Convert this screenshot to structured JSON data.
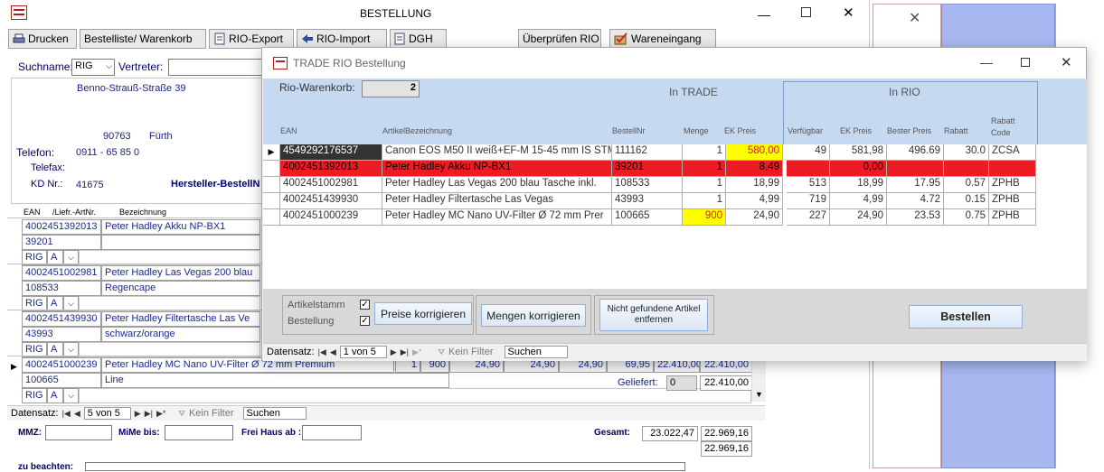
{
  "main_window": {
    "title": "BESTELLUNG",
    "toolbar": [
      {
        "label": "Drucken",
        "icon": "printer-icon"
      },
      {
        "label": "Bestelliste/ Warenkorb",
        "icon": ""
      },
      {
        "label": "RIO-Export",
        "icon": "export-icon"
      },
      {
        "label": "RIO-Import",
        "icon": "import-arrow-icon"
      },
      {
        "label": "DGH",
        "icon": "document-icon"
      },
      {
        "label": "Überprüfen RIO",
        "icon": ""
      },
      {
        "label": "Wareneingang",
        "icon": "goods-receipt-icon"
      }
    ],
    "search_label": "Suchname:",
    "search_value": "RIG",
    "vertreter_label": "Vertreter:",
    "address_street": "Benno-Strauß-Straße 39",
    "address_zip": "90763",
    "address_city": "Fürth",
    "telefon_label": "Telefon:",
    "telefon_value": "0911 - 65 85 0",
    "telefax_label": "Telefax:",
    "kd_label": "KD Nr.:",
    "kd_value": "41675",
    "hersteller_label": "Hersteller-BestellN",
    "list_headers": {
      "ean": "EAN",
      "liefr": "/Liefr.-ArtNr.",
      "bez": "Bezeichnung"
    },
    "items": [
      {
        "ean": "4002451392013",
        "name": "Peter Hadley Akku NP-BX1",
        "art": "39201",
        "sub": "",
        "code": "RIG",
        "flag": "A"
      },
      {
        "ean": "4002451002981",
        "name": "Peter Hadley Las Vegas 200 blau",
        "art": "108533",
        "sub": "Regencape",
        "code": "RIG",
        "flag": "A"
      },
      {
        "ean": "4002451439930",
        "name": "Peter Hadley Filtertasche Las Ve",
        "art": "43993",
        "sub": "schwarz/orange",
        "code": "RIG",
        "flag": "A"
      },
      {
        "ean": "4002451000239",
        "name": "Peter Hadley MC Nano UV-Filter Ø 72 mm Premium",
        "art": "100665",
        "sub": "Line",
        "code": "RIG",
        "flag": "A"
      }
    ],
    "last_row_values": [
      "1",
      "900",
      "24,90",
      "24,90",
      "24,90",
      "69,95",
      "22.410,00",
      "22.410,00"
    ],
    "geliefert_label": "Geliefert:",
    "geliefert_value": "0",
    "geliefert_total": "22.410,00",
    "nav_label": "Datensatz:",
    "nav_value": "5 von 5",
    "nav_filter": "Kein Filter",
    "nav_search": "Suchen",
    "mmz_label": "MMZ:",
    "mime_label": "MiMe bis:",
    "freihaus_label": "Frei Haus ab :",
    "gesamt_label": "Gesamt:",
    "gesamt_value1": "23.022,47",
    "gesamt_value2": "22.969,16",
    "gesamt_value3": "22.969,16",
    "beachten_label": "zu beachten:"
  },
  "rio_window": {
    "title": "TRADE RIO Bestellung",
    "warenkorb_label": "Rio-Warenkorb:",
    "warenkorb_value": "2",
    "in_trade": "In TRADE",
    "in_rio": "In RIO",
    "headers": {
      "ean": "EAN",
      "artikel": "ArtikelBezeichnung",
      "bestellnr": "BestellNr",
      "menge": "Menge",
      "ekpreis": "EK Preis",
      "verfuegbar": "Verfügbar",
      "rio_ek": "EK Preis",
      "bester": "Bester Preis",
      "rabatt": "Rabatt",
      "rabatt_code": "Rabatt Code"
    },
    "rows": [
      {
        "ean": "4549292176537",
        "artikel": "Canon EOS M50 II weiß+EF-M 15-45 mm IS STM",
        "bestellnr": "111162",
        "menge": "1",
        "ekpreis": "580,00",
        "verfuegbar": "49",
        "rio_ek": "581,98",
        "bester": "496.69",
        "rabatt": "30.0",
        "code": "ZCSA"
      },
      {
        "ean": "4002451392013",
        "artikel": "Peter Hadley Akku NP-BX1",
        "bestellnr": "39201",
        "menge": "1",
        "ekpreis": "8,49",
        "verfuegbar": "",
        "rio_ek": "0,00",
        "bester": "",
        "rabatt": "",
        "code": ""
      },
      {
        "ean": "4002451002981",
        "artikel": "Peter Hadley Las Vegas 200 blau Tasche inkl.",
        "bestellnr": "108533",
        "menge": "1",
        "ekpreis": "18,99",
        "verfuegbar": "513",
        "rio_ek": "18,99",
        "bester": "17.95",
        "rabatt": "0.57",
        "code": "ZPHB"
      },
      {
        "ean": "4002451439930",
        "artikel": "Peter Hadley Filtertasche Las Vegas",
        "bestellnr": "43993",
        "menge": "1",
        "ekpreis": "4,99",
        "verfuegbar": "719",
        "rio_ek": "4,99",
        "bester": "4.72",
        "rabatt": "0.15",
        "code": "ZPHB"
      },
      {
        "ean": "4002451000239",
        "artikel": "Peter Hadley MC Nano UV-Filter Ø 72 mm Prer",
        "bestellnr": "100665",
        "menge": "900",
        "ekpreis": "24,90",
        "verfuegbar": "227",
        "rio_ek": "24,90",
        "bester": "23.53",
        "rabatt": "0.75",
        "code": "ZPHB"
      }
    ],
    "artikelstamm_label": "Artikelstamm",
    "bestellung_label": "Bestellung",
    "btn_preise": "Preise korrigieren",
    "btn_mengen": "Mengen korrigieren",
    "btn_nicht": "Nicht gefundene Artikel entfernen",
    "btn_bestellen": "Bestellen",
    "nav_label": "Datensatz:",
    "nav_value": "1 von 5",
    "nav_filter": "Kein Filter",
    "nav_search": "Suchen"
  },
  "colors": {
    "highlight_yellow": "#ffff00",
    "error_red": "#ed1c24",
    "header_blue": "#c5d9f1"
  }
}
